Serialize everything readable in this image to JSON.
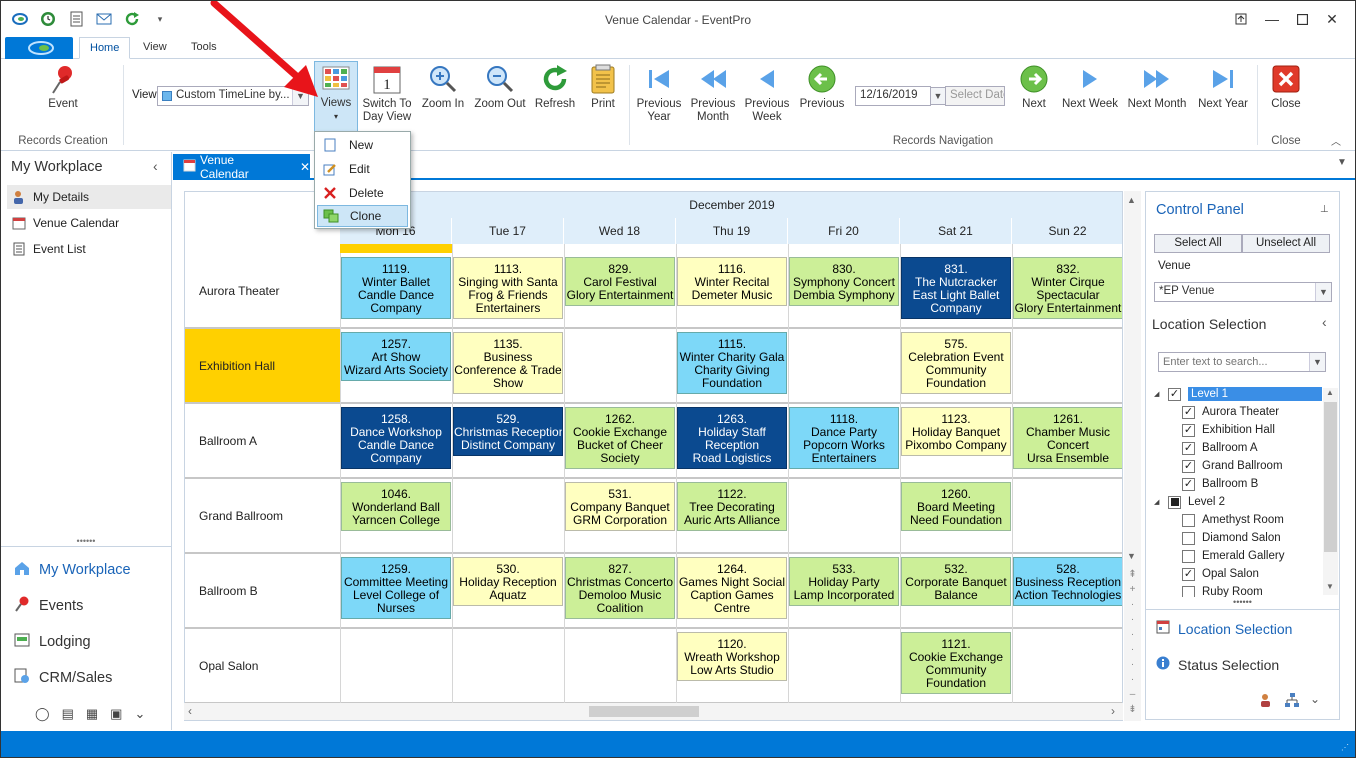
{
  "app": {
    "title": "Venue Calendar - EventPro",
    "ribbon_tabs": [
      "Home",
      "View",
      "Tools"
    ]
  },
  "ribbon": {
    "event_label": "Event",
    "records_creation_label": "Records Creation",
    "view_label": "View",
    "view_combo_value": "Custom TimeLine by...",
    "views_label": "Views",
    "switch_label_1": "Switch To",
    "switch_label_2": "Day View",
    "zoom_in_label": "Zoom In",
    "zoom_out_label": "Zoom Out",
    "refresh_label": "Refresh",
    "print_label": "Print",
    "prev_year_1": "Previous",
    "prev_year_2": "Year",
    "prev_month_1": "Previous",
    "prev_month_2": "Month",
    "prev_week_1": "Previous",
    "prev_week_2": "Week",
    "previous_label": "Previous",
    "date_value": "12/16/2019",
    "select_date_label": "Select Date",
    "next_label": "Next",
    "next_week_label": "Next Week",
    "next_month_label": "Next Month",
    "next_year_label": "Next Year",
    "records_navigation_label": "Records Navigation",
    "close_label": "Close",
    "close_group_label": "Close"
  },
  "views_menu": {
    "items": [
      "New",
      "Edit",
      "Delete",
      "Clone"
    ],
    "highlighted": "Clone"
  },
  "left_pane": {
    "title": "My Workplace",
    "items": [
      "My Details",
      "Venue Calendar",
      "Event List"
    ],
    "nav": [
      "My Workplace",
      "Events",
      "Lodging",
      "CRM/Sales"
    ]
  },
  "doc_tab": {
    "label": "Venue Calendar"
  },
  "calendar": {
    "month": "December 2019",
    "days": [
      "Mon 16",
      "Tue 17",
      "Wed 18",
      "Thu 19",
      "Fri 20",
      "Sat 21",
      "Sun 22"
    ],
    "rows": [
      "Aurora Theater",
      "Exhibition Hall",
      "Ballroom A",
      "Grand Ballroom",
      "Ballroom B",
      "Opal Salon"
    ],
    "events": [
      {
        "row": 0,
        "day": 0,
        "color": "cyan",
        "lines": [
          "1119.",
          "Winter Ballet",
          "Candle Dance",
          "Company"
        ]
      },
      {
        "row": 0,
        "day": 1,
        "color": "yellow",
        "lines": [
          "1113.",
          "Singing with Santa",
          "Frog & Friends",
          "Entertainers"
        ]
      },
      {
        "row": 0,
        "day": 2,
        "color": "green",
        "lines": [
          "829.",
          "Carol Festival",
          "Glory Entertainment"
        ]
      },
      {
        "row": 0,
        "day": 3,
        "color": "yellow",
        "lines": [
          "1116.",
          "Winter Recital",
          "Demeter Music"
        ]
      },
      {
        "row": 0,
        "day": 4,
        "color": "green",
        "lines": [
          "830.",
          "Symphony Concert",
          "Dembia Symphony"
        ]
      },
      {
        "row": 0,
        "day": 5,
        "color": "navy",
        "lines": [
          "831.",
          "The Nutcracker",
          "East Light Ballet",
          "Company"
        ]
      },
      {
        "row": 0,
        "day": 6,
        "color": "green",
        "lines": [
          "832.",
          "Winter Cirque",
          "Spectacular",
          "Glory Entertainment"
        ]
      },
      {
        "row": 1,
        "day": 0,
        "color": "cyan",
        "lines": [
          "1257.",
          "Art Show",
          "Wizard Arts Society"
        ]
      },
      {
        "row": 1,
        "day": 1,
        "color": "yellow",
        "lines": [
          "1135.",
          "Business",
          "Conference & Trade",
          "Show"
        ]
      },
      {
        "row": 1,
        "day": 3,
        "color": "cyan",
        "lines": [
          "1115.",
          "Winter Charity Gala",
          "Charity Giving",
          "Foundation"
        ]
      },
      {
        "row": 1,
        "day": 5,
        "color": "yellow",
        "lines": [
          "575.",
          "Celebration Event",
          "Community",
          "Foundation"
        ]
      },
      {
        "row": 2,
        "day": 0,
        "color": "navy",
        "lines": [
          "1258.",
          "Dance Workshop",
          "Candle Dance",
          "Company"
        ]
      },
      {
        "row": 2,
        "day": 1,
        "color": "navy",
        "lines": [
          "529.",
          "Christmas Reception",
          "Distinct Company"
        ]
      },
      {
        "row": 2,
        "day": 2,
        "color": "green",
        "lines": [
          "1262.",
          "Cookie Exchange",
          "Bucket of Cheer",
          "Society"
        ]
      },
      {
        "row": 2,
        "day": 3,
        "color": "navy",
        "lines": [
          "1263.",
          "Holiday Staff",
          "Reception",
          "Road Logistics"
        ]
      },
      {
        "row": 2,
        "day": 4,
        "color": "cyan",
        "lines": [
          "1118.",
          "Dance Party",
          "Popcorn Works",
          "Entertainers"
        ]
      },
      {
        "row": 2,
        "day": 5,
        "color": "yellow",
        "lines": [
          "1123.",
          "Holiday Banquet",
          "Pixombo Company"
        ]
      },
      {
        "row": 2,
        "day": 6,
        "color": "green",
        "lines": [
          "1261.",
          "Chamber Music",
          "Concert",
          "Ursa Ensemble"
        ]
      },
      {
        "row": 3,
        "day": 0,
        "color": "green",
        "lines": [
          "1046.",
          "Wonderland Ball",
          "Yarncen College"
        ]
      },
      {
        "row": 3,
        "day": 2,
        "color": "yellow",
        "lines": [
          "531.",
          "Company Banquet",
          "GRM Corporation"
        ]
      },
      {
        "row": 3,
        "day": 3,
        "color": "green",
        "lines": [
          "1122.",
          "Tree Decorating",
          "Auric Arts Alliance"
        ]
      },
      {
        "row": 3,
        "day": 5,
        "color": "green",
        "lines": [
          "1260.",
          "Board Meeting",
          "Need Foundation"
        ]
      },
      {
        "row": 4,
        "day": 0,
        "color": "cyan",
        "lines": [
          "1259.",
          "Committee Meeting",
          "Level College of",
          "Nurses"
        ]
      },
      {
        "row": 4,
        "day": 1,
        "color": "yellow",
        "lines": [
          "530.",
          "Holiday Reception",
          "Aquatz"
        ]
      },
      {
        "row": 4,
        "day": 2,
        "color": "green",
        "lines": [
          "827.",
          "Christmas Concerto",
          "Demoloo Music",
          "Coalition"
        ]
      },
      {
        "row": 4,
        "day": 3,
        "color": "yellow",
        "lines": [
          "1264.",
          "Games Night Social",
          "Caption Games",
          "Centre"
        ]
      },
      {
        "row": 4,
        "day": 4,
        "color": "green",
        "lines": [
          "533.",
          "Holiday Party",
          "Lamp Incorporated"
        ]
      },
      {
        "row": 4,
        "day": 5,
        "color": "green",
        "lines": [
          "532.",
          "Corporate Banquet",
          "Balance"
        ]
      },
      {
        "row": 4,
        "day": 6,
        "color": "cyan",
        "lines": [
          "528.",
          "Business Reception",
          "Action Technologies"
        ]
      },
      {
        "row": 5,
        "day": 3,
        "color": "yellow",
        "lines": [
          "1120.",
          "Wreath Workshop",
          "Low Arts Studio"
        ]
      },
      {
        "row": 5,
        "day": 5,
        "color": "green",
        "lines": [
          "1121.",
          "Cookie Exchange",
          "Community",
          "Foundation"
        ]
      }
    ]
  },
  "control_panel": {
    "title": "Control Panel",
    "select_all": "Select All",
    "unselect_all": "Unselect All",
    "venue_label": "Venue",
    "venue_value": "*EP Venue",
    "location_selection": "Location Selection",
    "search_placeholder": "Enter text to search...",
    "tree": [
      {
        "label": "Level 1",
        "level": 0,
        "checked": "checked",
        "expanded": true,
        "selected": true
      },
      {
        "label": "Aurora Theater",
        "level": 1,
        "checked": "checked"
      },
      {
        "label": "Exhibition Hall",
        "level": 1,
        "checked": "checked"
      },
      {
        "label": "Ballroom A",
        "level": 1,
        "checked": "checked"
      },
      {
        "label": "Grand Ballroom",
        "level": 1,
        "checked": "checked"
      },
      {
        "label": "Ballroom B",
        "level": 1,
        "checked": "checked"
      },
      {
        "label": "Level 2",
        "level": 0,
        "checked": "partial",
        "expanded": true
      },
      {
        "label": "Amethyst Room",
        "level": 1,
        "checked": "unchecked"
      },
      {
        "label": "Diamond Salon",
        "level": 1,
        "checked": "unchecked"
      },
      {
        "label": "Emerald Gallery",
        "level": 1,
        "checked": "unchecked"
      },
      {
        "label": "Opal Salon",
        "level": 1,
        "checked": "checked"
      },
      {
        "label": "Ruby Room",
        "level": 1,
        "checked": "unchecked"
      }
    ],
    "location_selection_link": "Location Selection",
    "status_selection_link": "Status Selection"
  },
  "colors": {
    "accent": "#0078d7",
    "cyan": "#7dd8f8",
    "yellow": "#ffffc0",
    "green": "#ccef98",
    "navy": "#0b4a90",
    "highlight_row": "#ffd000"
  }
}
